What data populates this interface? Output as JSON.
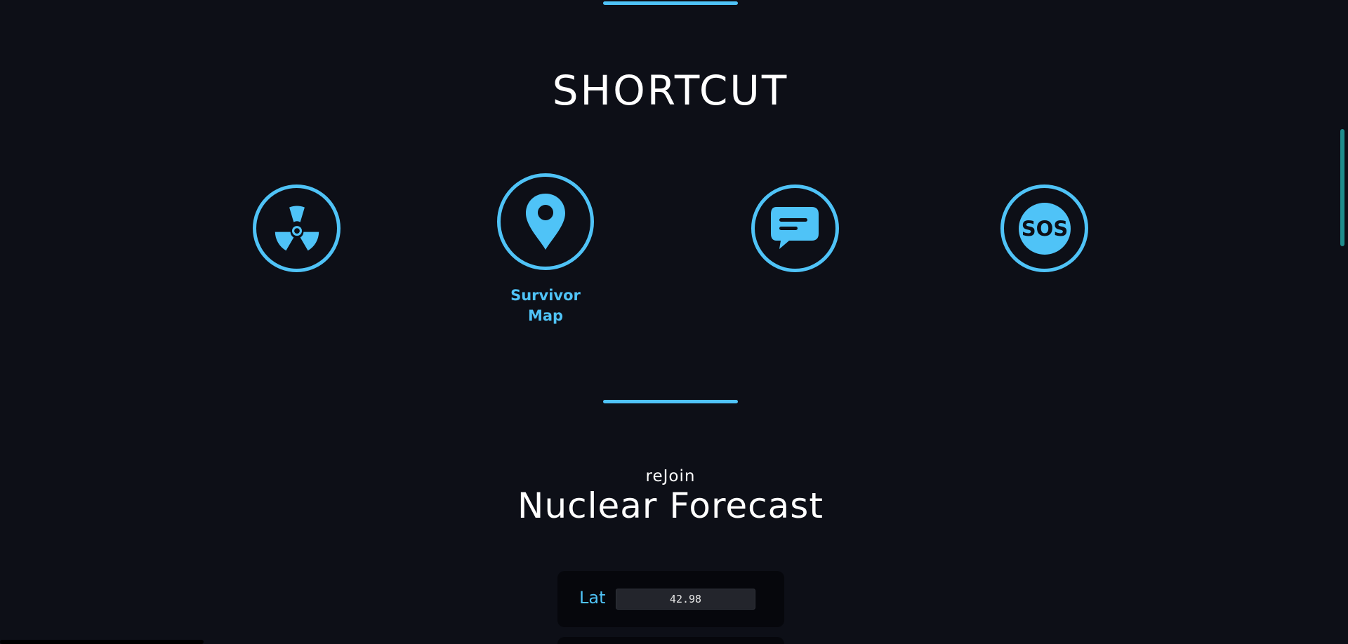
{
  "section": {
    "title": "SHORTCUT"
  },
  "shortcuts": [
    {
      "icon": "radiation-icon",
      "label": ""
    },
    {
      "icon": "map-pin-icon",
      "label": "Survivor\nMap"
    },
    {
      "icon": "chat-bubble-icon",
      "label": ""
    },
    {
      "icon": "sos-icon",
      "label": ""
    }
  ],
  "forecast": {
    "overline": "reJoin",
    "title": "Nuclear Forecast",
    "lat_label": "Lat",
    "lat_value": "42.98"
  },
  "colors": {
    "background": "#0d0f17",
    "accent": "#4fc3f7",
    "card": "#06070c",
    "input": "#23252c",
    "scrollbar": "#1e8c8c"
  }
}
